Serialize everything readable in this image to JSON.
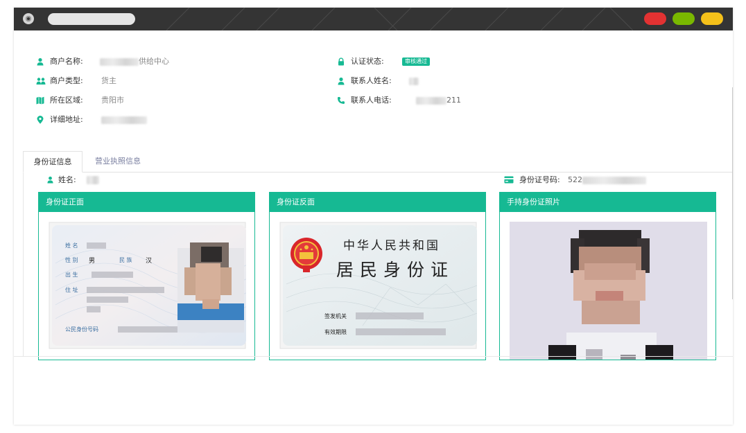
{
  "window": {
    "address_bar": ""
  },
  "merchant": {
    "name_label": "商户名称:",
    "name_value": "供给中心",
    "type_label": "商户类型:",
    "type_value": "货主",
    "region_label": "所在区域:",
    "region_value": "贵阳市",
    "address_label": "详细地址:",
    "address_value": "",
    "auth_label": "认证状态:",
    "auth_badge": "审核通过",
    "contact_name_label": "联系人姓名:",
    "contact_phone_label": "联系人电话:",
    "contact_phone_value": "211"
  },
  "tabs": [
    {
      "label": "身份证信息",
      "active": true
    },
    {
      "label": "营业执照信息",
      "active": false
    }
  ],
  "idinfo": {
    "name_label": "姓名:",
    "idno_label": "身份证号码:",
    "idno_value": "522"
  },
  "cards": [
    {
      "title": "身份证正面",
      "fields": {
        "name": "姓 名",
        "sex": "性 别",
        "sex_value": "男",
        "ethnic": "民 族",
        "ethnic_value": "汉",
        "birth": "出 生",
        "addr": "住 址",
        "idno": "公民身份号码"
      }
    },
    {
      "title": "身份证反面",
      "fields": {
        "line1": "中华人民共和国",
        "line2": "居民身份证",
        "authority": "签发机关",
        "validity": "有效期限"
      }
    },
    {
      "title": "手持身份证照片"
    }
  ],
  "colors": {
    "accent": "#16b993",
    "titlebar": "#343434",
    "red": "#e33232",
    "green": "#7ab800",
    "yellow": "#f5c11a"
  },
  "icons": [
    "user-icon",
    "users-icon",
    "map-icon",
    "location-pin-icon",
    "lock-icon",
    "phone-icon",
    "id-card-icon"
  ]
}
